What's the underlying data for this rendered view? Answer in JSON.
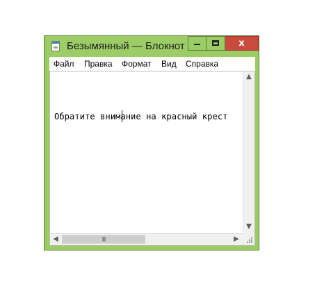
{
  "window": {
    "title": "Безымянный — Блокнот",
    "accent_color": "#9ccc65",
    "close_color": "#c84b3e",
    "buttons": {
      "minimize_icon": "minimize-icon",
      "maximize_icon": "maximize-icon",
      "close_symbol": "x"
    }
  },
  "menu": {
    "items": [
      "Файл",
      "Правка",
      "Формат",
      "Вид",
      "Справка"
    ]
  },
  "editor": {
    "text": "Обратите внимание на красный крест"
  },
  "scrollbars": {
    "up_icon": "chevron-up-icon",
    "down_icon": "chevron-down-icon",
    "left_icon": "chevron-left-icon",
    "right_icon": "chevron-right-icon",
    "thumb_grip": "III"
  }
}
